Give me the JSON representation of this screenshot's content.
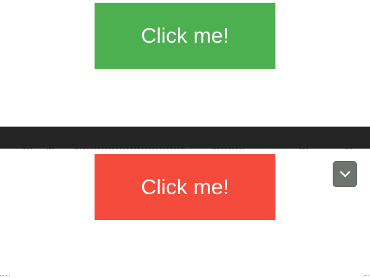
{
  "buttons": {
    "primary_label": "Click me!",
    "secondary_label": "Click me!"
  },
  "colors": {
    "green_button": "#4caf50",
    "red_button": "#f44b3c",
    "dark_bar": "#242424",
    "scroll_toggle": "#707470"
  },
  "icons": {
    "scroll_toggle": "chevron-down-icon"
  }
}
